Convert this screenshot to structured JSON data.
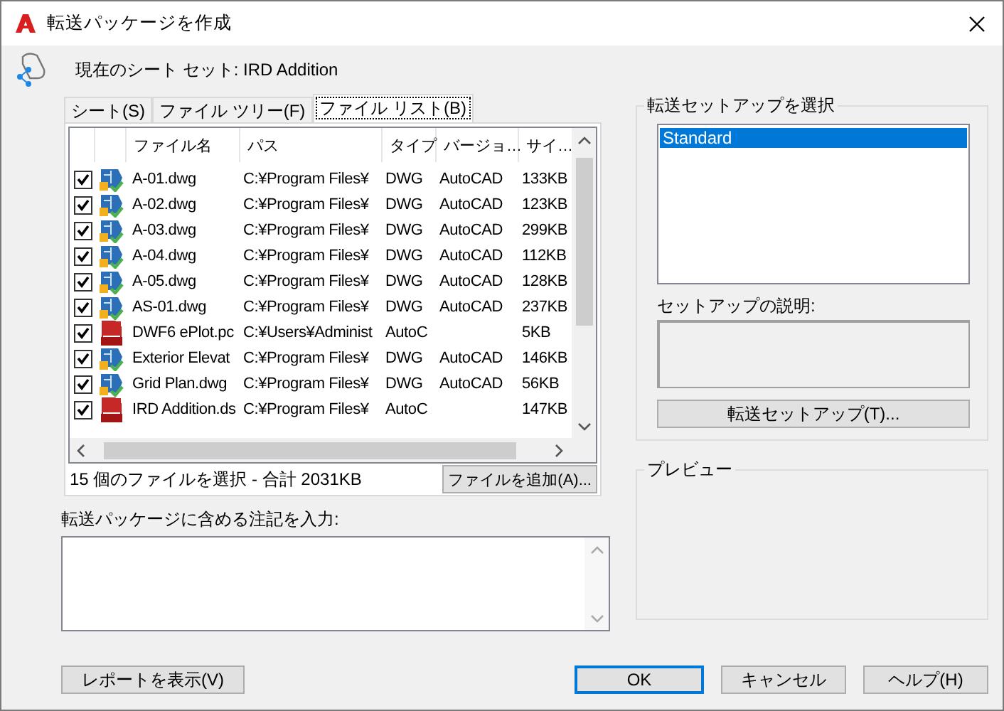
{
  "window": {
    "title": "転送パッケージを作成"
  },
  "current_sheet_set": "現在のシート セット: IRD Addition",
  "tabs": [
    {
      "label": "シート(S)",
      "selected": false
    },
    {
      "label": "ファイル ツリー(F)",
      "selected": false
    },
    {
      "label": "ファイル リスト(B)",
      "selected": true
    }
  ],
  "file_list": {
    "columns": [
      "ファイル名",
      "パス",
      "タイプ",
      "バージョ…",
      "サイ…"
    ],
    "rows": [
      {
        "checked": true,
        "kind": "dwg",
        "name": "A-01.dwg",
        "path": "C:¥Program Files¥",
        "type": "DWG",
        "version": "AutoCAD",
        "size": "133KB"
      },
      {
        "checked": true,
        "kind": "dwg",
        "name": "A-02.dwg",
        "path": "C:¥Program Files¥",
        "type": "DWG",
        "version": "AutoCAD",
        "size": "123KB"
      },
      {
        "checked": true,
        "kind": "dwg",
        "name": "A-03.dwg",
        "path": "C:¥Program Files¥",
        "type": "DWG",
        "version": "AutoCAD",
        "size": "299KB"
      },
      {
        "checked": true,
        "kind": "dwg",
        "name": "A-04.dwg",
        "path": "C:¥Program Files¥",
        "type": "DWG",
        "version": "AutoCAD",
        "size": "112KB"
      },
      {
        "checked": true,
        "kind": "dwg",
        "name": "A-05.dwg",
        "path": "C:¥Program Files¥",
        "type": "DWG",
        "version": "AutoCAD",
        "size": "128KB"
      },
      {
        "checked": true,
        "kind": "dwg",
        "name": "AS-01.dwg",
        "path": "C:¥Program Files¥",
        "type": "DWG",
        "version": "AutoCAD",
        "size": "237KB"
      },
      {
        "checked": true,
        "kind": "plot",
        "name": "DWF6 ePlot.pc",
        "path": "C:¥Users¥Administ",
        "type": "AutoC",
        "size": "5KB"
      },
      {
        "checked": true,
        "kind": "dwg",
        "name": "Exterior Elevat",
        "path": "C:¥Program Files¥",
        "type": "DWG",
        "version": "AutoCAD",
        "size": "146KB"
      },
      {
        "checked": true,
        "kind": "dwg",
        "name": "Grid Plan.dwg",
        "path": "C:¥Program Files¥",
        "type": "DWG",
        "version": "AutoCAD",
        "size": "56KB"
      },
      {
        "checked": true,
        "kind": "plot",
        "name": "IRD Addition.ds",
        "path": "C:¥Program Files¥",
        "type": "AutoC",
        "size": "147KB"
      }
    ]
  },
  "summary": "15 個のファイルを選択 - 合計 2031KB",
  "add_file_button": "ファイルを追加(A)...",
  "notes": {
    "label": "転送パッケージに含める注記を入力:"
  },
  "setup": {
    "title": "転送セットアップを選択",
    "items": [
      {
        "label": "Standard",
        "selected": true
      }
    ],
    "description_label": "セットアップの説明:",
    "button": "転送セットアップ(T)..."
  },
  "preview": {
    "title": "プレビュー"
  },
  "buttons": [
    {
      "label": "レポートを表示(V)",
      "default": false
    },
    {
      "label": "OK",
      "default": true
    },
    {
      "label": "キャンセル",
      "default": false
    },
    {
      "label": "ヘルプ(H)",
      "default": false
    }
  ]
}
